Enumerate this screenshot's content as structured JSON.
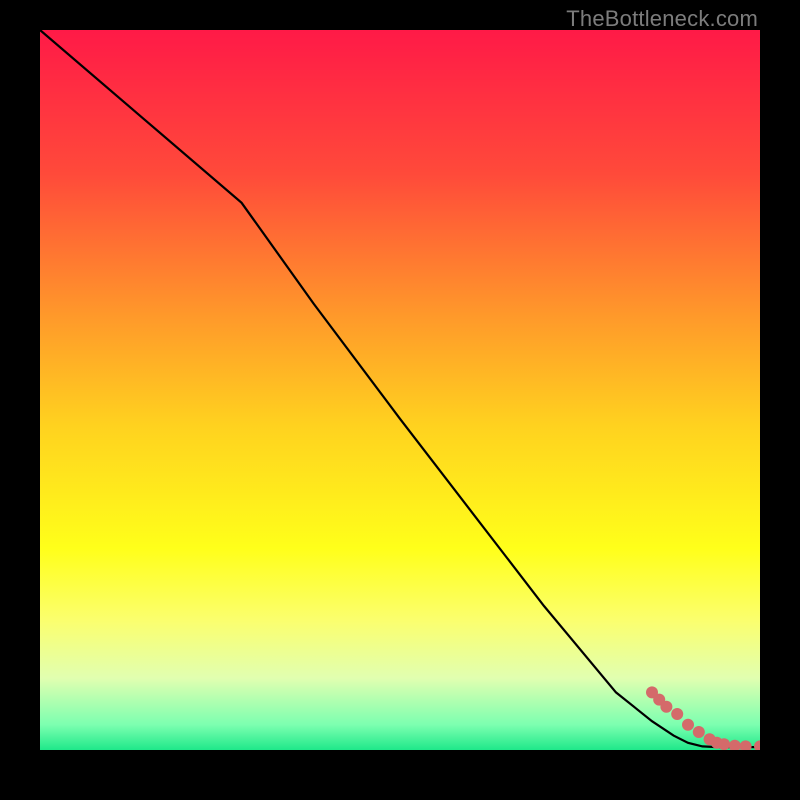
{
  "watermark": "TheBottleneck.com",
  "chart_data": {
    "type": "line",
    "title": "",
    "xlabel": "",
    "ylabel": "",
    "xlim": [
      0,
      100
    ],
    "ylim": [
      0,
      100
    ],
    "grid": false,
    "legend": false,
    "gradient_stops": [
      {
        "offset": 0.0,
        "color": "#ff1a47"
      },
      {
        "offset": 0.2,
        "color": "#ff4a3a"
      },
      {
        "offset": 0.4,
        "color": "#ff9a2a"
      },
      {
        "offset": 0.55,
        "color": "#ffd21f"
      },
      {
        "offset": 0.72,
        "color": "#ffff1a"
      },
      {
        "offset": 0.82,
        "color": "#fbff6e"
      },
      {
        "offset": 0.9,
        "color": "#e1ffb0"
      },
      {
        "offset": 0.965,
        "color": "#7cffb0"
      },
      {
        "offset": 1.0,
        "color": "#1fe88a"
      }
    ],
    "series": [
      {
        "name": "curve",
        "stroke": "#000000",
        "x": [
          0,
          14,
          28,
          38,
          50,
          60,
          70,
          80,
          85,
          88,
          90,
          92,
          94,
          96,
          98,
          100
        ],
        "y": [
          100,
          88,
          76,
          62,
          46,
          33,
          20,
          8,
          4,
          2,
          1,
          0.5,
          0.4,
          0.4,
          0.4,
          0.4
        ]
      }
    ],
    "markers": {
      "name": "tail-dots",
      "color": "#d46a6a",
      "radius_main": 6,
      "x": [
        85,
        86,
        87,
        88.5,
        90,
        91.5,
        93,
        94,
        95,
        96.5,
        98,
        100
      ],
      "y": [
        8,
        7,
        6,
        5,
        3.5,
        2.5,
        1.5,
        1,
        0.8,
        0.6,
        0.5,
        0.5
      ]
    }
  }
}
